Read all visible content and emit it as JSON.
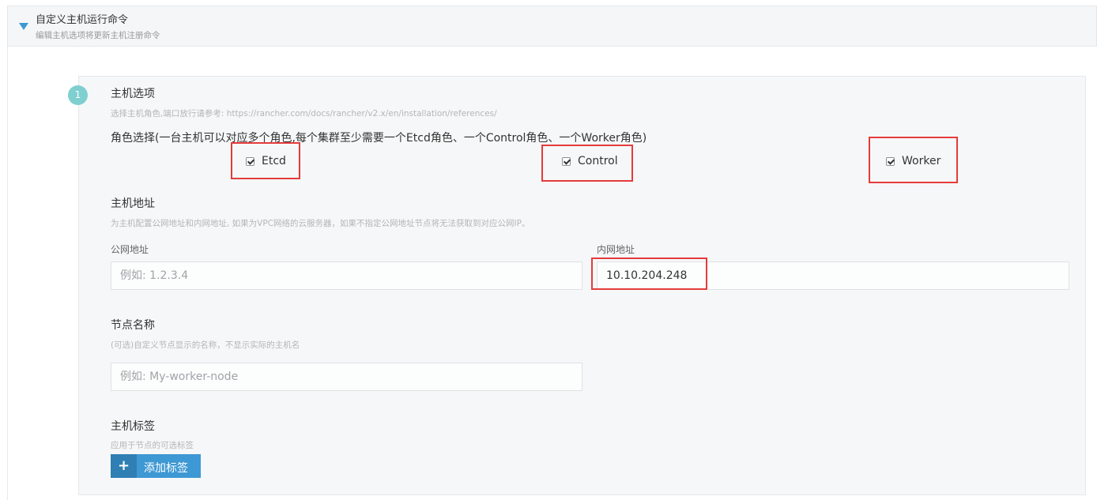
{
  "section": {
    "title": "自定义主机运行命令",
    "subtitle": "编辑主机选项将更新主机注册命令"
  },
  "step": {
    "number": "1"
  },
  "host_options": {
    "title": "主机选项",
    "hint": "选择主机角色,端口放行请参考: https://rancher.com/docs/rancher/v2.x/en/installation/references/",
    "roles_label": "角色选择(一台主机可以对应多个角色,每个集群至少需要一个Etcd角色、一个Control角色、一个Worker角色)",
    "roles": [
      {
        "label": "Etcd",
        "checked": true
      },
      {
        "label": "Control",
        "checked": true
      },
      {
        "label": "Worker",
        "checked": true
      }
    ]
  },
  "address": {
    "title": "主机地址",
    "hint": "为主机配置公网地址和内网地址, 如果为VPC网络的云服务器，如果不指定公网地址节点将无法获取到对应公网IP。",
    "public_label": "公网地址",
    "public_placeholder": "例如: 1.2.3.4",
    "public_value": "",
    "internal_label": "内网地址",
    "internal_value": "10.10.204.248"
  },
  "node_name": {
    "title": "节点名称",
    "hint": "(可选)自定义节点显示的名称，不显示实际的主机名",
    "placeholder": "例如: My-worker-node",
    "value": ""
  },
  "labels": {
    "title": "主机标签",
    "hint": "应用于节点的可选标签",
    "add_button": "添加标签",
    "add_icon": "+"
  },
  "colors": {
    "accent": "#3d98d3",
    "highlight": "#e53b3b",
    "step": "#7fcfd0"
  }
}
